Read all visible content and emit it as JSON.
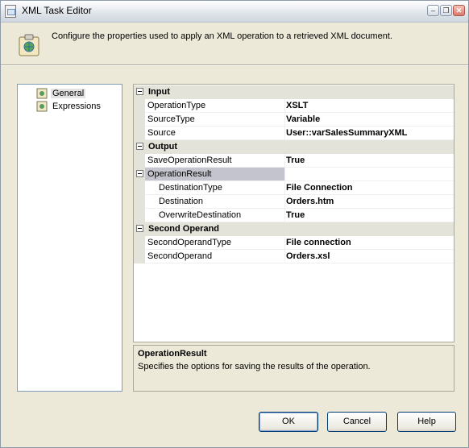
{
  "window": {
    "title": "XML Task Editor",
    "minimize_glyph": "–",
    "restore_glyph": "❐",
    "close_glyph": "✕"
  },
  "description": "Configure the properties used to apply an XML operation to a retrieved XML document.",
  "tree": {
    "items": [
      {
        "label": "General",
        "selected": true,
        "icon": "property-page-icon"
      },
      {
        "label": "Expressions",
        "selected": false,
        "icon": "property-page-icon"
      }
    ]
  },
  "grid": {
    "input": {
      "label": "Input",
      "rows": [
        {
          "name": "OperationType",
          "value": "XSLT"
        },
        {
          "name": "SourceType",
          "value": "Variable"
        },
        {
          "name": "Source",
          "value": "User::varSalesSummaryXML"
        }
      ]
    },
    "output": {
      "label": "Output",
      "save": {
        "name": "SaveOperationResult",
        "value": "True"
      },
      "operation_result": {
        "name": "OperationResult",
        "value": ""
      },
      "sub_rows": [
        {
          "name": "DestinationType",
          "value": "File Connection"
        },
        {
          "name": "Destination",
          "value": "Orders.htm"
        },
        {
          "name": "OverwriteDestination",
          "value": "True"
        }
      ]
    },
    "second": {
      "label": "Second Operand",
      "rows": [
        {
          "name": "SecondOperandType",
          "value": "File connection"
        },
        {
          "name": "SecondOperand",
          "value": "Orders.xsl"
        }
      ]
    }
  },
  "help": {
    "title": "OperationResult",
    "text": "Specifies the options for saving the results of the operation."
  },
  "buttons": {
    "ok": "OK",
    "cancel": "Cancel",
    "help": "Help"
  }
}
